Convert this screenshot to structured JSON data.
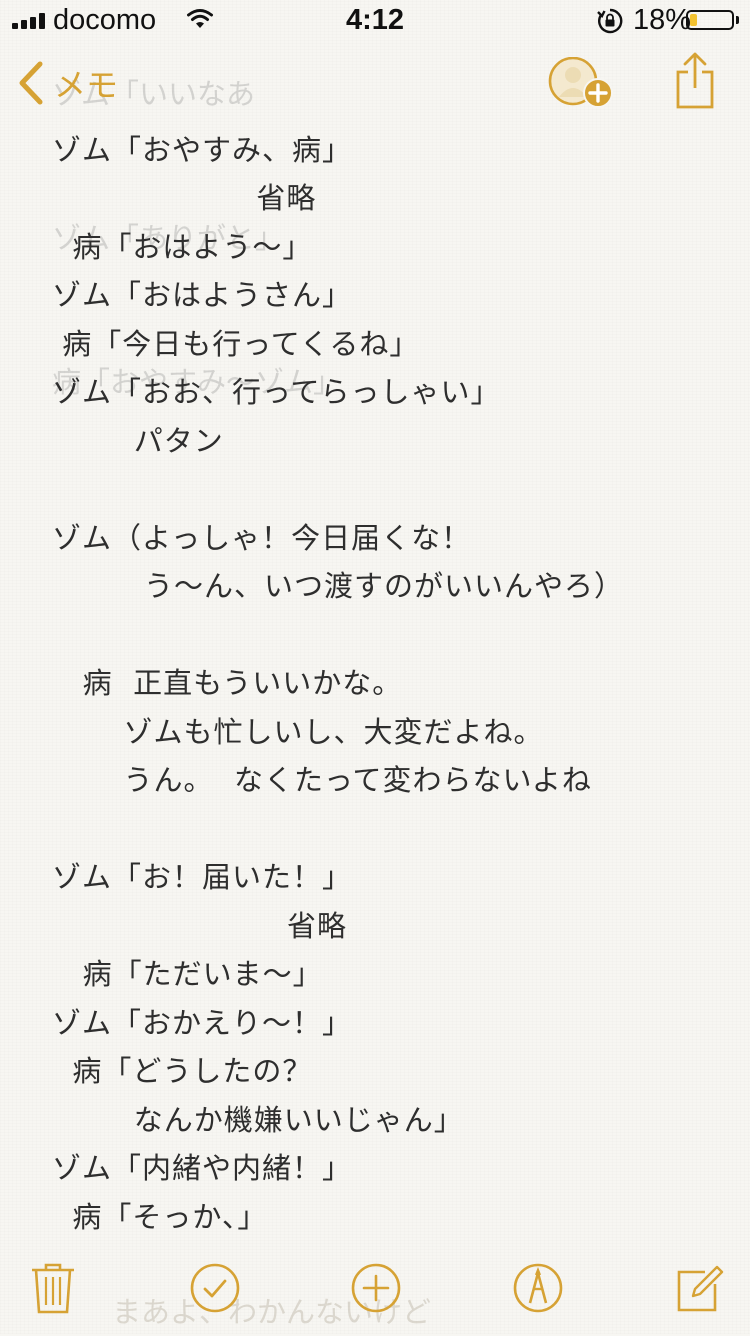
{
  "status_bar": {
    "carrier": "docomo",
    "time": "4:12",
    "battery_percent_text": "18%",
    "battery_level": 0.18,
    "icons": [
      "signal-bars-icon",
      "wifi-icon",
      "rotation-lock-icon",
      "battery-icon"
    ]
  },
  "nav": {
    "back_label": "メモ",
    "icons": [
      "chevron-left-icon",
      "add-person-icon",
      "share-icon"
    ],
    "accent_color": "#d6a234"
  },
  "ghost_lines": [
    "ゾム「いいなあ",
    "ゾム「ありがと」",
    "病「おやすみ～ゾム」"
  ],
  "note": {
    "lines": [
      "ゾム「おやすみ、病」",
      "                    省略",
      "  病「おはよう～」",
      "ゾム「おはようさん」",
      " 病「今日も行ってくるね」",
      "ゾム「おお、行ってらっしゃい」",
      "        パタン",
      "",
      "ゾム（よっしゃ！今日届くな！",
      "         う～ん、いつ渡すのがいいんやろ）",
      "",
      "   病  正直もういいかな。",
      "       ゾムも忙しいし、大変だよね。",
      "       うん。  なくたって変わらないよね",
      "",
      "ゾム「お！届いた！」",
      "                       省略",
      "   病「ただいま～」",
      "ゾム「おかえり～！」",
      "  病「どうしたの？",
      "        なんか機嫌いいじゃん」",
      "ゾム「内緒や内緒！」",
      "  病「そっか、」"
    ],
    "trailing_faded": "まあよ、わかんないけど"
  },
  "toolbar": {
    "items": [
      "trash-icon",
      "checklist-icon",
      "add-icon",
      "sketch-icon",
      "compose-icon"
    ]
  }
}
